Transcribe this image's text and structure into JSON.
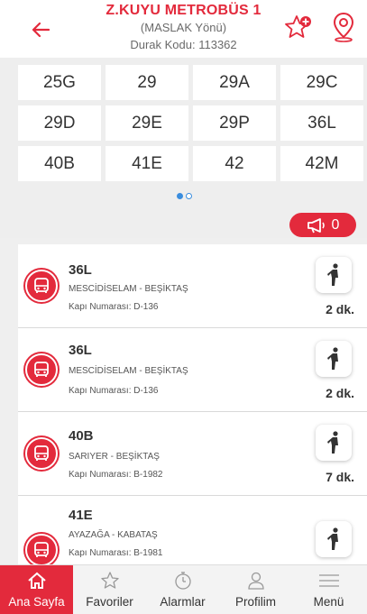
{
  "header": {
    "title": "Z.KUYU METROBÜS 1",
    "direction": "(MASLAK Yönü)",
    "stop_code": "Durak Kodu: 113362"
  },
  "routes": [
    {
      "label": "25G"
    },
    {
      "label": "29"
    },
    {
      "label": "29A"
    },
    {
      "label": "29C"
    },
    {
      "label": "29D"
    },
    {
      "label": "29E"
    },
    {
      "label": "29P"
    },
    {
      "label": "36L"
    },
    {
      "label": "40B"
    },
    {
      "label": "41E"
    },
    {
      "label": "42"
    },
    {
      "label": "42M"
    }
  ],
  "pagination": {
    "pages": 2,
    "active": 0
  },
  "announcements": {
    "count": "0"
  },
  "arrivals": [
    {
      "route": "36L",
      "direction": "MESCİDİSELAM - BEŞİKTAŞ",
      "door": "Kapı Numarası: D-136",
      "eta": "2 dk."
    },
    {
      "route": "36L",
      "direction": "MESCİDİSELAM - BEŞİKTAŞ",
      "door": "Kapı Numarası: D-136",
      "eta": "2 dk."
    },
    {
      "route": "40B",
      "direction": "SARIYER - BEŞİKTAŞ",
      "door": "Kapı Numarası: B-1982",
      "eta": "7 dk."
    },
    {
      "route": "41E",
      "direction": "AYAZAĞA - KABATAŞ",
      "door": "Kapı Numarası: B-1981",
      "eta": ""
    }
  ],
  "tabs": [
    {
      "label": "Ana Sayfa",
      "icon": "home-icon",
      "active": true
    },
    {
      "label": "Favoriler",
      "icon": "star-icon",
      "active": false
    },
    {
      "label": "Alarmlar",
      "icon": "stopwatch-icon",
      "active": false
    },
    {
      "label": "Profilim",
      "icon": "user-icon",
      "active": false
    },
    {
      "label": "Menü",
      "icon": "menu-icon",
      "active": false
    }
  ],
  "colors": {
    "accent": "#e32a3c",
    "dot_active": "#3a8dde"
  }
}
